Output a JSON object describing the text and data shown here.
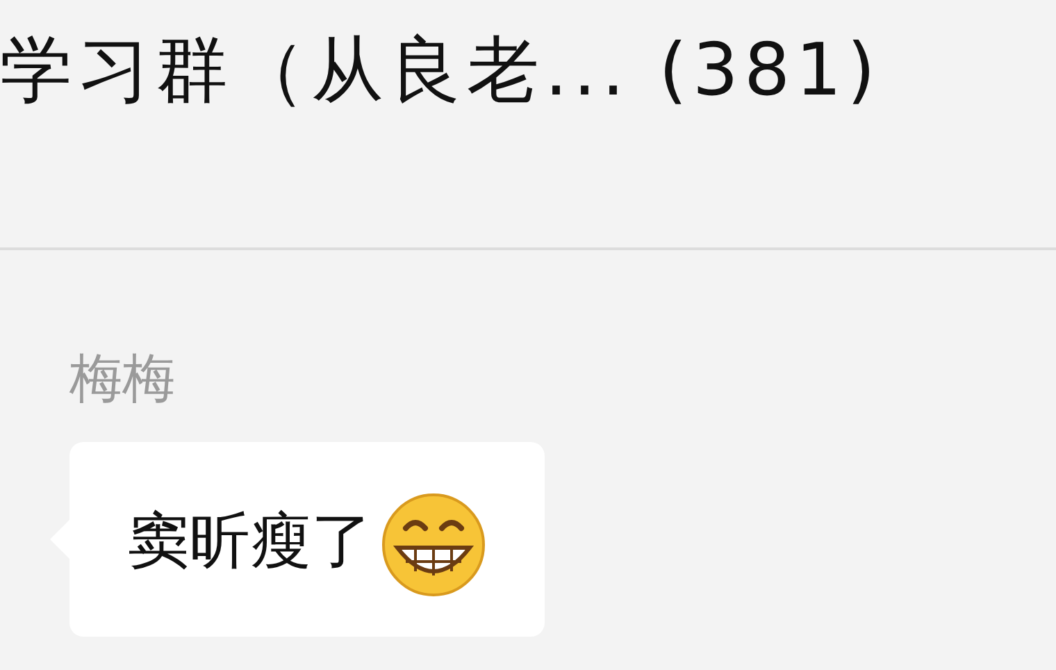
{
  "header": {
    "title": "学习群（从良老... (381)"
  },
  "messages": [
    {
      "sender": "梅梅",
      "text": "窦昕瘦了",
      "kind": "text_with_grin"
    }
  ]
}
